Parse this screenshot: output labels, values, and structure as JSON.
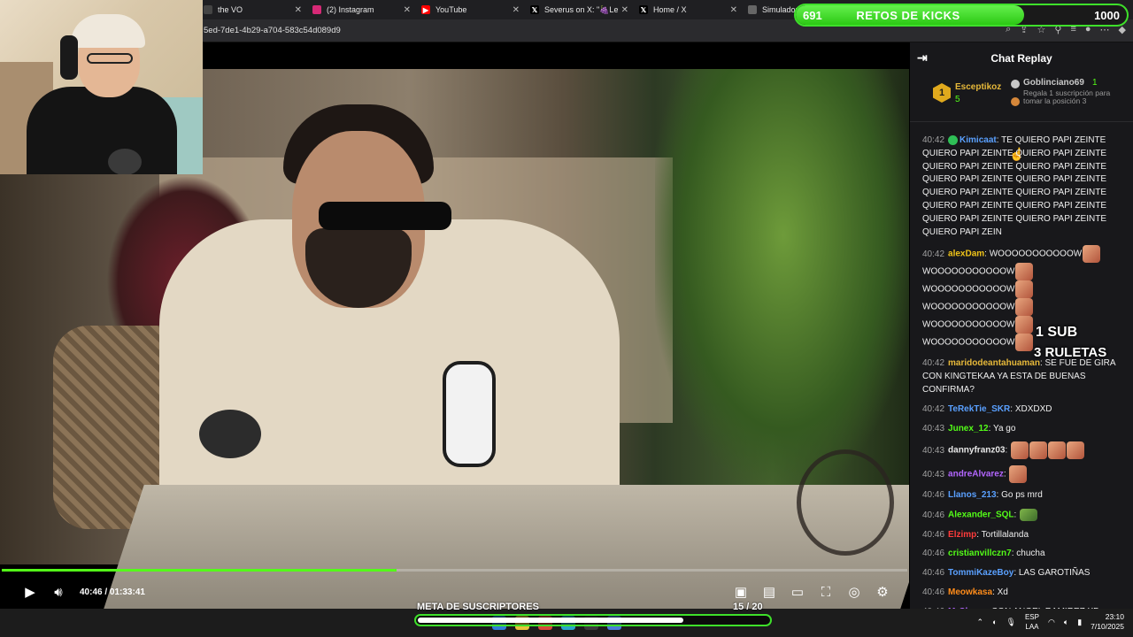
{
  "browser": {
    "tabs": [
      {
        "label": "the VO",
        "icon": "generic-icon",
        "color": "#444444"
      },
      {
        "label": "(2) Instagram",
        "icon": "instagram-icon",
        "color": "#d62976"
      },
      {
        "label": "YouTube",
        "icon": "youtube-icon",
        "color": "#ff0000"
      },
      {
        "label": "Severus on X: \"🍇Leye",
        "icon": "x-icon",
        "color": "#000000"
      },
      {
        "label": "Home / X",
        "icon": "x-icon",
        "color": "#000000"
      },
      {
        "label": "Simulador de Alineació",
        "icon": "generic-icon",
        "color": "#666666"
      }
    ],
    "url": "5ed-7de1-4b29-a704-583c54d089d9"
  },
  "kicks": {
    "current": "691",
    "title": "RETOS DE KICKS",
    "goal": "1000",
    "progress": 0.691,
    "color": "#53fc18"
  },
  "player": {
    "time": "40:46 / 01:33:41",
    "progress": 0.436
  },
  "chat": {
    "title": "Chat Replay",
    "leaderboard": {
      "first": {
        "rank": "1",
        "name": "Esceptikoz",
        "count": "5"
      },
      "second": {
        "name": "Goblinciano69",
        "count": "1"
      },
      "third_text": "Regala 1 suscripción para tomar la posición 3"
    },
    "messages": [
      {
        "ts": "40:42",
        "user": "Kimicaat",
        "color": "#5aa0ff",
        "verified": true,
        "text": "TE QUIERO PAPI ZEINTE QUIERO PAPI ZEINTE QUIERO PAPI ZEINTE QUIERO PAPI ZEINTE QUIERO PAPI ZEINTE QUIERO PAPI ZEINTE QUIERO PAPI ZEINTE QUIERO PAPI ZEINTE QUIERO PAPI ZEINTE QUIERO PAPI ZEINTE QUIERO PAPI ZEINTE QUIERO PAPI ZEINTE QUIERO PAPI ZEINTE QUIERO PAPI ZEIN",
        "emotes": 0
      },
      {
        "ts": "40:42",
        "user": "alexDam",
        "color": "#f0c419",
        "text": "WOOOOOOOOOOOW",
        "lines": [
          "WOOOOOOOOOOOW",
          "WOOOOOOOOOOOW",
          "WOOOOOOOOOOOW",
          "WOOOOOOOOOOOW",
          "WOOOOOOOOOOOW"
        ],
        "emotes": 1
      },
      {
        "ts": "40:42",
        "user": "maridodeantahuaman",
        "color": "#e7b93a",
        "text": "SE FUE DE GIRA CON KINGTEKAA YA ESTA DE BUENAS CONFIRMA?",
        "emotes": 0
      },
      {
        "ts": "40:42",
        "user": "TeRekTie_SKR",
        "color": "#5aa0ff",
        "text": "XDXDXD",
        "emotes": 0
      },
      {
        "ts": "40:43",
        "user": "Junex_12",
        "color": "#53fc18",
        "text": "Ya go",
        "emotes": 0
      },
      {
        "ts": "40:43",
        "user": "dannyfranz03",
        "color": "#e8e8e8",
        "text": "",
        "emotes": 4
      },
      {
        "ts": "40:43",
        "user": "andreAlvarez",
        "color": "#b366ff",
        "text": "",
        "emotes": 1
      },
      {
        "ts": "40:46",
        "user": "Llanos_213",
        "color": "#5aa0ff",
        "text": "Go ps mrd",
        "emotes": 0
      },
      {
        "ts": "40:46",
        "user": "Alexander_SQL",
        "color": "#53fc18",
        "text": "",
        "emotes": 1,
        "emote_type": "frog"
      },
      {
        "ts": "40:46",
        "user": "Elzimp",
        "color": "#ff3b3b",
        "text": "Tortillalanda",
        "emotes": 0
      },
      {
        "ts": "40:46",
        "user": "cristianvillczn7",
        "color": "#53fc18",
        "text": "chucha",
        "emotes": 0
      },
      {
        "ts": "40:46",
        "user": "TommiKazeBoy",
        "color": "#5aa0ff",
        "text": "LAS GAROTIÑAS",
        "emotes": 0
      },
      {
        "ts": "40:46",
        "user": "Meowkasa",
        "color": "#ff8c1a",
        "text": "Xd",
        "emotes": 0
      },
      {
        "ts": "40:46",
        "user": "MrChoso",
        "color": "#b366ff",
        "text": "CON ANGEL RAMIREZ XD",
        "emotes": 0
      }
    ]
  },
  "overlay": {
    "line1": "1 SUB",
    "line2": "3 RULETAS"
  },
  "subgoal": {
    "title": "META DE SUSCRIPTORES",
    "count": "15 / 20",
    "progress": 0.75
  },
  "taskbar": {
    "lang_top": "ESP",
    "lang_bottom": "LAA",
    "time": "23:10",
    "date": "7/10/2025"
  }
}
